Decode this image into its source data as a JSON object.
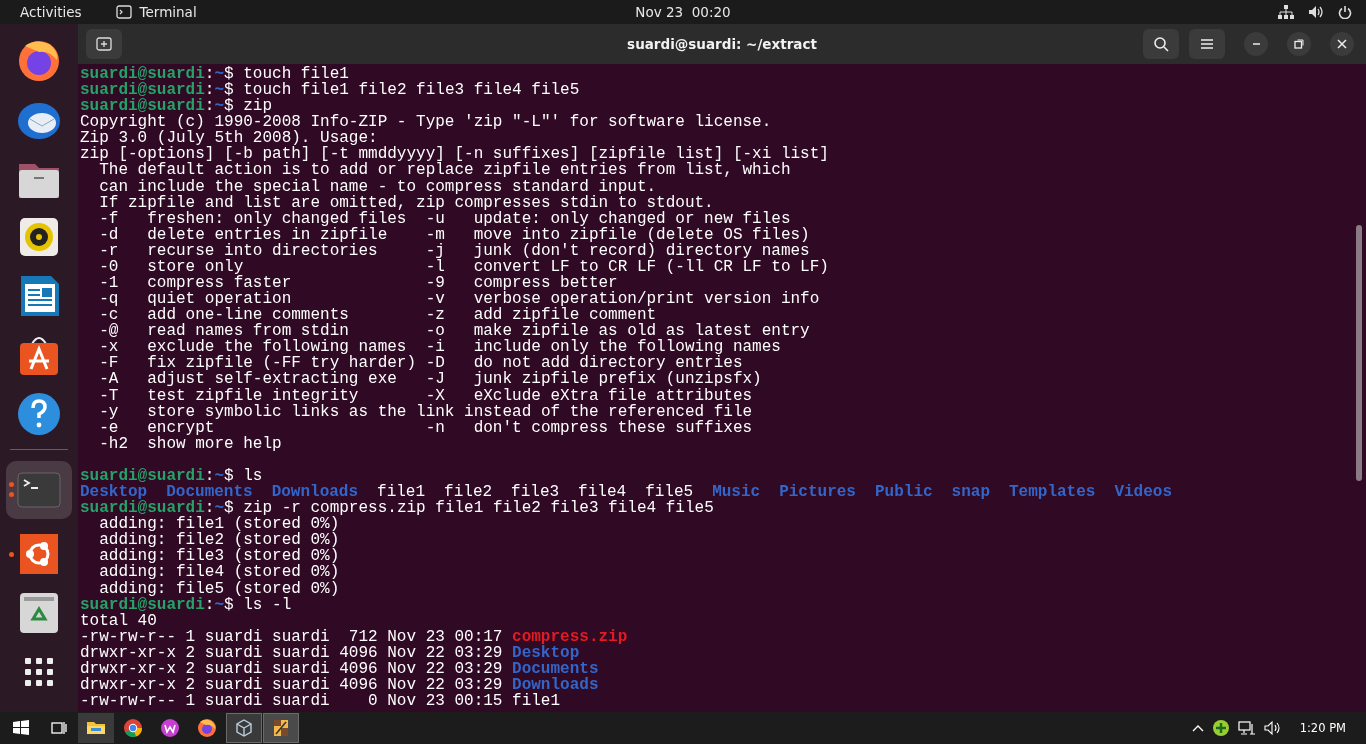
{
  "top_bar": {
    "activities": "Activities",
    "app_menu": "Terminal",
    "clock": "Nov 23  00:20"
  },
  "dock": {
    "items": [
      {
        "kind": "browser",
        "running": false,
        "focused": false,
        "multiple_windows": false
      },
      {
        "kind": "mail",
        "running": false,
        "focused": false,
        "multiple_windows": false
      },
      {
        "kind": "files",
        "running": false,
        "focused": false,
        "multiple_windows": false
      },
      {
        "kind": "music",
        "running": false,
        "focused": false,
        "multiple_windows": false
      },
      {
        "kind": "writer",
        "running": false,
        "focused": false,
        "multiple_windows": false
      },
      {
        "kind": "store",
        "running": false,
        "focused": false,
        "multiple_windows": false
      },
      {
        "kind": "help",
        "running": false,
        "focused": false,
        "multiple_windows": false
      },
      {
        "kind": "separator"
      },
      {
        "kind": "terminal",
        "running": true,
        "focused": true,
        "multiple_windows": true
      },
      {
        "kind": "ubuntu",
        "running": true,
        "focused": false,
        "multiple_windows": false
      },
      {
        "kind": "trash",
        "running": false,
        "focused": false,
        "multiple_windows": false
      },
      {
        "kind": "apps"
      }
    ]
  },
  "window": {
    "title": "suardi@suardi: ~/extract"
  },
  "terminal": {
    "lines": [
      {
        "kind": "prompt",
        "user": "suardi@suardi",
        "separator": ":",
        "path": "~",
        "command": "$ touch file1"
      },
      {
        "kind": "prompt",
        "user": "suardi@suardi",
        "separator": ":",
        "path": "~",
        "command": "$ touch file1 file2 file3 file4 file5"
      },
      {
        "kind": "prompt",
        "user": "suardi@suardi",
        "separator": ":",
        "path": "~",
        "command": "$ zip"
      },
      {
        "kind": "output",
        "text": "Copyright (c) 1990-2008 Info-ZIP - Type 'zip \"-L\"' for software license."
      },
      {
        "kind": "output",
        "text": "Zip 3.0 (July 5th 2008). Usage:"
      },
      {
        "kind": "output",
        "text": "zip [-options] [-b path] [-t mmddyyyy] [-n suffixes] [zipfile list] [-xi list]"
      },
      {
        "kind": "output",
        "text": "  The default action is to add or replace zipfile entries from list, which"
      },
      {
        "kind": "output",
        "text": "  can include the special name - to compress standard input."
      },
      {
        "kind": "output",
        "text": "  If zipfile and list are omitted, zip compresses stdin to stdout."
      },
      {
        "kind": "output",
        "text": "  -f   freshen: only changed files  -u   update: only changed or new files"
      },
      {
        "kind": "output",
        "text": "  -d   delete entries in zipfile    -m   move into zipfile (delete OS files)"
      },
      {
        "kind": "output",
        "text": "  -r   recurse into directories     -j   junk (don't record) directory names"
      },
      {
        "kind": "output",
        "text": "  -0   store only                   -l   convert LF to CR LF (-ll CR LF to LF)"
      },
      {
        "kind": "output",
        "text": "  -1   compress faster              -9   compress better"
      },
      {
        "kind": "output",
        "text": "  -q   quiet operation              -v   verbose operation/print version info"
      },
      {
        "kind": "output",
        "text": "  -c   add one-line comments        -z   add zipfile comment"
      },
      {
        "kind": "output",
        "text": "  -@   read names from stdin        -o   make zipfile as old as latest entry"
      },
      {
        "kind": "output",
        "text": "  -x   exclude the following names  -i   include only the following names"
      },
      {
        "kind": "output",
        "text": "  -F   fix zipfile (-FF try harder) -D   do not add directory entries"
      },
      {
        "kind": "output",
        "text": "  -A   adjust self-extracting exe   -J   junk zipfile prefix (unzipsfx)"
      },
      {
        "kind": "output",
        "text": "  -T   test zipfile integrity       -X   eXclude eXtra file attributes"
      },
      {
        "kind": "output",
        "text": "  -y   store symbolic links as the link instead of the referenced file"
      },
      {
        "kind": "output",
        "text": "  -e   encrypt                      -n   don't compress these suffixes"
      },
      {
        "kind": "output",
        "text": "  -h2  show more help"
      },
      {
        "kind": "blank"
      },
      {
        "kind": "prompt",
        "user": "suardi@suardi",
        "separator": ":",
        "path": "~",
        "command": "$ ls"
      },
      {
        "kind": "listing",
        "entries": [
          {
            "kind": "dir",
            "name": "Desktop"
          },
          {
            "kind": "dir",
            "name": "Documents"
          },
          {
            "kind": "dir",
            "name": "Downloads"
          },
          {
            "kind": "file",
            "name": "file1"
          },
          {
            "kind": "file",
            "name": "file2"
          },
          {
            "kind": "file",
            "name": "file3"
          },
          {
            "kind": "file",
            "name": "file4"
          },
          {
            "kind": "file",
            "name": "file5"
          },
          {
            "kind": "dir",
            "name": "Music"
          },
          {
            "kind": "dir",
            "name": "Pictures"
          },
          {
            "kind": "dir",
            "name": "Public"
          },
          {
            "kind": "dir",
            "name": "snap"
          },
          {
            "kind": "dir",
            "name": "Templates"
          },
          {
            "kind": "dir",
            "name": "Videos"
          }
        ]
      },
      {
        "kind": "prompt",
        "user": "suardi@suardi",
        "separator": ":",
        "path": "~",
        "command": "$ zip -r compress.zip file1 file2 file3 file4 file5"
      },
      {
        "kind": "output",
        "text": "  adding: file1 (stored 0%)"
      },
      {
        "kind": "output",
        "text": "  adding: file2 (stored 0%)"
      },
      {
        "kind": "output",
        "text": "  adding: file3 (stored 0%)"
      },
      {
        "kind": "output",
        "text": "  adding: file4 (stored 0%)"
      },
      {
        "kind": "output",
        "text": "  adding: file5 (stored 0%)"
      },
      {
        "kind": "prompt",
        "user": "suardi@suardi",
        "separator": ":",
        "path": "~",
        "command": "$ ls -l"
      },
      {
        "kind": "output",
        "text": "total 40"
      },
      {
        "kind": "long",
        "prefix": "-rw-rw-r-- 1 suardi suardi  712 Nov 23 00:17",
        "entry": {
          "kind": "archive",
          "name": "compress.zip"
        }
      },
      {
        "kind": "long",
        "prefix": "drwxr-xr-x 2 suardi suardi 4096 Nov 22 03:29",
        "entry": {
          "kind": "dir",
          "name": "Desktop"
        }
      },
      {
        "kind": "long",
        "prefix": "drwxr-xr-x 2 suardi suardi 4096 Nov 22 03:29",
        "entry": {
          "kind": "dir",
          "name": "Documents"
        }
      },
      {
        "kind": "long",
        "prefix": "drwxr-xr-x 2 suardi suardi 4096 Nov 22 03:29",
        "entry": {
          "kind": "dir",
          "name": "Downloads"
        }
      },
      {
        "kind": "long",
        "prefix": "-rw-rw-r-- 1 suardi suardi    0 Nov 23 00:15",
        "entry": {
          "kind": "file",
          "name": "file1"
        }
      }
    ]
  },
  "taskbar": {
    "apps": [
      {
        "kind": "explorer",
        "open": true,
        "active": false
      },
      {
        "kind": "chrome",
        "open": false,
        "active": false
      },
      {
        "kind": "wbrowser",
        "open": false,
        "active": false
      },
      {
        "kind": "firefox",
        "open": false,
        "active": false
      },
      {
        "kind": "cube",
        "open": true,
        "active": false
      },
      {
        "kind": "mosaic",
        "open": true,
        "active": true
      }
    ],
    "clock": "1:20 PM"
  }
}
